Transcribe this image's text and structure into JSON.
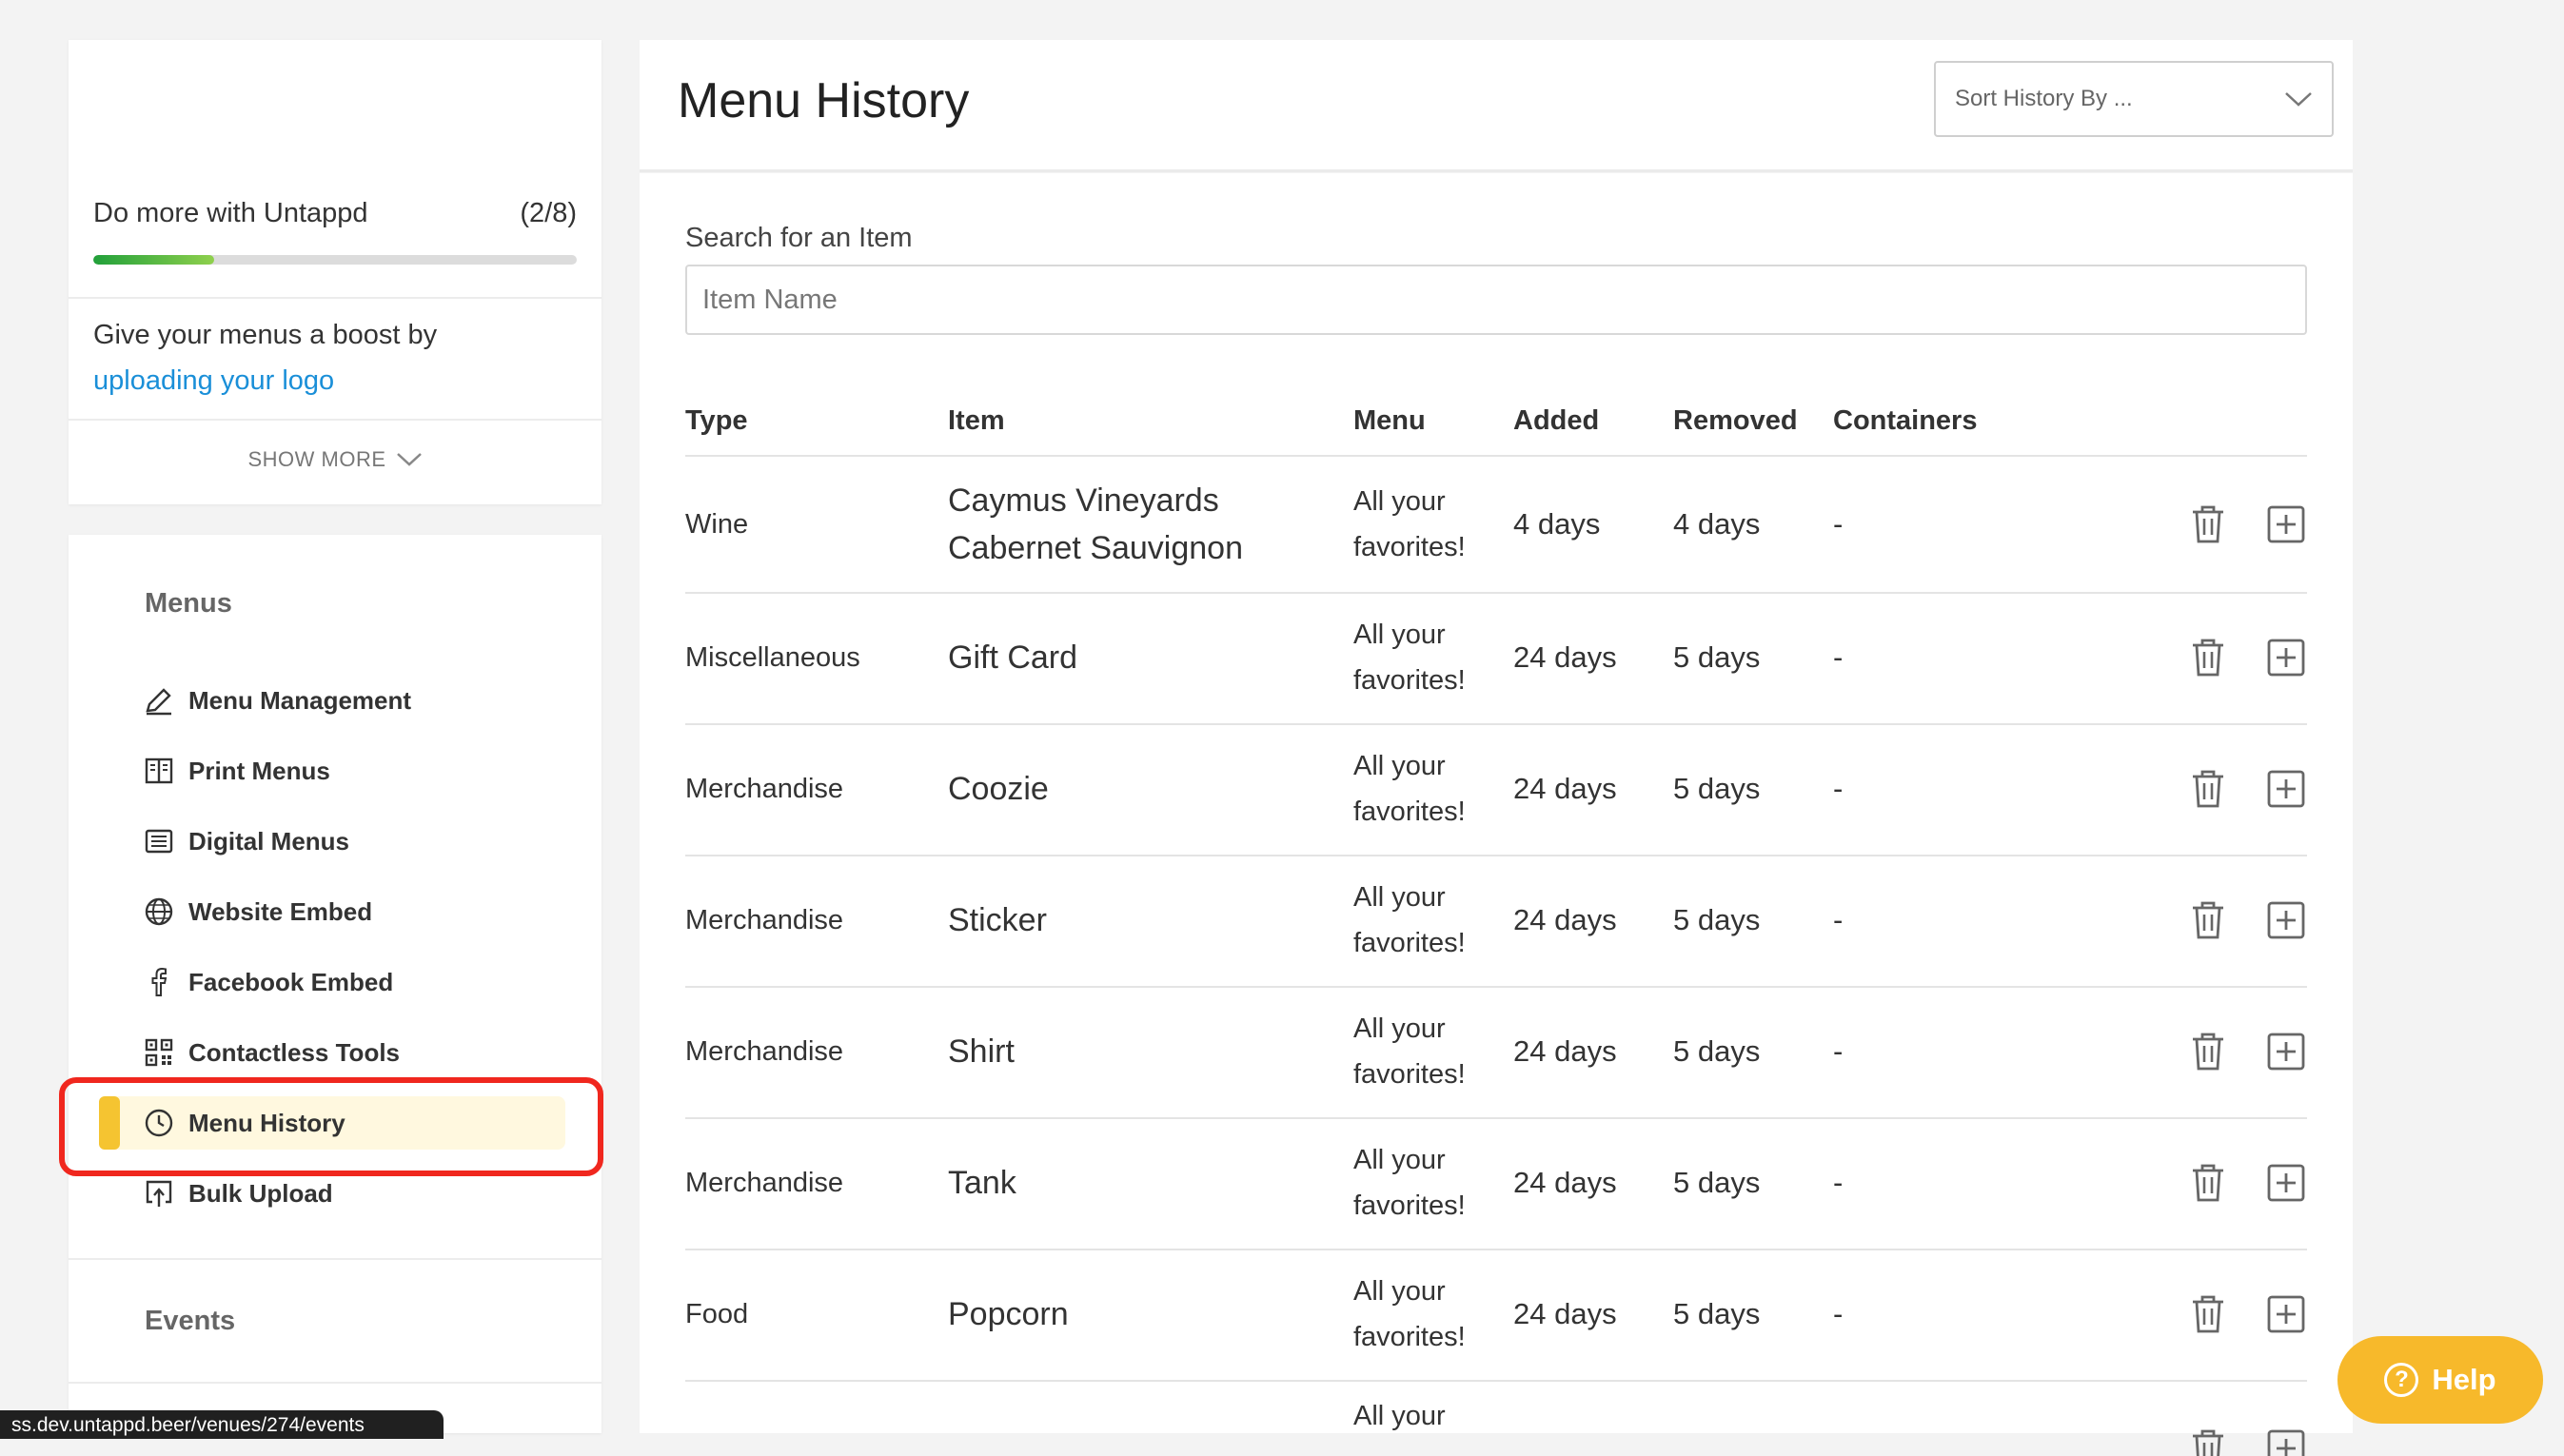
{
  "promo": {
    "title": "Do more with Untappd",
    "progress_text": "(2/8)",
    "progress_fraction": 0.25,
    "body_text": "Give your menus a boost by",
    "link_text": "uploading your logo",
    "show_more": "SHOW MORE"
  },
  "nav": {
    "menus_title": "Menus",
    "items": [
      {
        "label": "Menu Management",
        "icon": "pencil-icon"
      },
      {
        "label": "Print Menus",
        "icon": "book-icon"
      },
      {
        "label": "Digital Menus",
        "icon": "screen-list-icon"
      },
      {
        "label": "Website Embed",
        "icon": "globe-icon"
      },
      {
        "label": "Facebook Embed",
        "icon": "facebook-icon"
      },
      {
        "label": "Contactless Tools",
        "icon": "qr-code-icon"
      },
      {
        "label": "Menu History",
        "icon": "clock-icon",
        "active": true
      },
      {
        "label": "Bulk Upload",
        "icon": "upload-icon"
      }
    ],
    "events_title": "Events"
  },
  "status_url": "ss.dev.untappd.beer/venues/274/events",
  "header": {
    "title": "Menu History",
    "sort_placeholder": "Sort History By ..."
  },
  "search": {
    "label": "Search for an Item",
    "placeholder": "Item Name",
    "value": ""
  },
  "table": {
    "columns": [
      "Type",
      "Item",
      "Menu",
      "Added",
      "Removed",
      "Containers"
    ],
    "rows": [
      {
        "type": "Wine",
        "item": "Caymus Vineyards Cabernet Sauvignon",
        "menu": "All your favorites!",
        "added": "4 days",
        "removed": "4 days",
        "containers": "-"
      },
      {
        "type": "Miscellaneous",
        "item": "Gift Card",
        "menu": "All your favorites!",
        "added": "24 days",
        "removed": "5 days",
        "containers": "-"
      },
      {
        "type": "Merchandise",
        "item": "Coozie",
        "menu": "All your favorites!",
        "added": "24 days",
        "removed": "5 days",
        "containers": "-"
      },
      {
        "type": "Merchandise",
        "item": "Sticker",
        "menu": "All your favorites!",
        "added": "24 days",
        "removed": "5 days",
        "containers": "-"
      },
      {
        "type": "Merchandise",
        "item": "Shirt",
        "menu": "All your favorites!",
        "added": "24 days",
        "removed": "5 days",
        "containers": "-"
      },
      {
        "type": "Merchandise",
        "item": "Tank",
        "menu": "All your favorites!",
        "added": "24 days",
        "removed": "5 days",
        "containers": "-"
      },
      {
        "type": "Food",
        "item": "Popcorn",
        "menu": "All your favorites!",
        "added": "24 days",
        "removed": "5 days",
        "containers": "-"
      },
      {
        "type": "",
        "item": "",
        "menu": "All your",
        "added": "",
        "removed": "",
        "containers": ""
      }
    ]
  },
  "help": {
    "label": "Help",
    "icon": "question-icon"
  },
  "colors": {
    "accent_yellow": "#f5c431",
    "link_blue": "#1a8fd8",
    "progress_green": "#21a03a",
    "highlight_red": "#f0271e",
    "help_orange": "#f7b92b"
  }
}
